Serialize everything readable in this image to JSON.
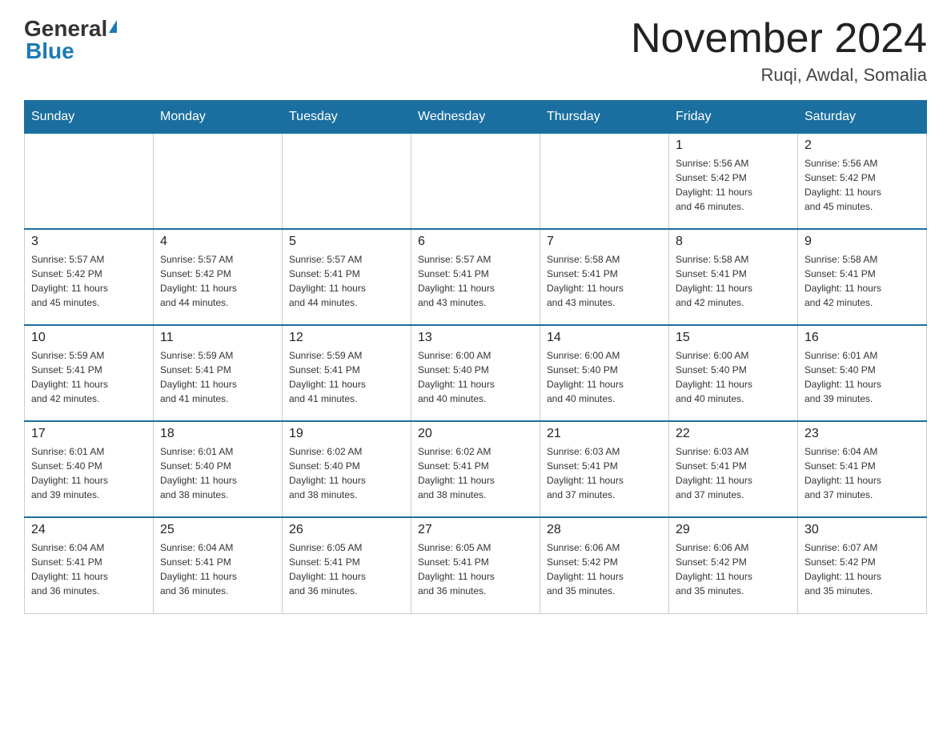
{
  "header": {
    "logo_general": "General",
    "logo_blue": "Blue",
    "month_title": "November 2024",
    "location": "Ruqi, Awdal, Somalia"
  },
  "weekdays": [
    "Sunday",
    "Monday",
    "Tuesday",
    "Wednesday",
    "Thursday",
    "Friday",
    "Saturday"
  ],
  "weeks": [
    [
      {
        "day": "",
        "info": ""
      },
      {
        "day": "",
        "info": ""
      },
      {
        "day": "",
        "info": ""
      },
      {
        "day": "",
        "info": ""
      },
      {
        "day": "",
        "info": ""
      },
      {
        "day": "1",
        "info": "Sunrise: 5:56 AM\nSunset: 5:42 PM\nDaylight: 11 hours\nand 46 minutes."
      },
      {
        "day": "2",
        "info": "Sunrise: 5:56 AM\nSunset: 5:42 PM\nDaylight: 11 hours\nand 45 minutes."
      }
    ],
    [
      {
        "day": "3",
        "info": "Sunrise: 5:57 AM\nSunset: 5:42 PM\nDaylight: 11 hours\nand 45 minutes."
      },
      {
        "day": "4",
        "info": "Sunrise: 5:57 AM\nSunset: 5:42 PM\nDaylight: 11 hours\nand 44 minutes."
      },
      {
        "day": "5",
        "info": "Sunrise: 5:57 AM\nSunset: 5:41 PM\nDaylight: 11 hours\nand 44 minutes."
      },
      {
        "day": "6",
        "info": "Sunrise: 5:57 AM\nSunset: 5:41 PM\nDaylight: 11 hours\nand 43 minutes."
      },
      {
        "day": "7",
        "info": "Sunrise: 5:58 AM\nSunset: 5:41 PM\nDaylight: 11 hours\nand 43 minutes."
      },
      {
        "day": "8",
        "info": "Sunrise: 5:58 AM\nSunset: 5:41 PM\nDaylight: 11 hours\nand 42 minutes."
      },
      {
        "day": "9",
        "info": "Sunrise: 5:58 AM\nSunset: 5:41 PM\nDaylight: 11 hours\nand 42 minutes."
      }
    ],
    [
      {
        "day": "10",
        "info": "Sunrise: 5:59 AM\nSunset: 5:41 PM\nDaylight: 11 hours\nand 42 minutes."
      },
      {
        "day": "11",
        "info": "Sunrise: 5:59 AM\nSunset: 5:41 PM\nDaylight: 11 hours\nand 41 minutes."
      },
      {
        "day": "12",
        "info": "Sunrise: 5:59 AM\nSunset: 5:41 PM\nDaylight: 11 hours\nand 41 minutes."
      },
      {
        "day": "13",
        "info": "Sunrise: 6:00 AM\nSunset: 5:40 PM\nDaylight: 11 hours\nand 40 minutes."
      },
      {
        "day": "14",
        "info": "Sunrise: 6:00 AM\nSunset: 5:40 PM\nDaylight: 11 hours\nand 40 minutes."
      },
      {
        "day": "15",
        "info": "Sunrise: 6:00 AM\nSunset: 5:40 PM\nDaylight: 11 hours\nand 40 minutes."
      },
      {
        "day": "16",
        "info": "Sunrise: 6:01 AM\nSunset: 5:40 PM\nDaylight: 11 hours\nand 39 minutes."
      }
    ],
    [
      {
        "day": "17",
        "info": "Sunrise: 6:01 AM\nSunset: 5:40 PM\nDaylight: 11 hours\nand 39 minutes."
      },
      {
        "day": "18",
        "info": "Sunrise: 6:01 AM\nSunset: 5:40 PM\nDaylight: 11 hours\nand 38 minutes."
      },
      {
        "day": "19",
        "info": "Sunrise: 6:02 AM\nSunset: 5:40 PM\nDaylight: 11 hours\nand 38 minutes."
      },
      {
        "day": "20",
        "info": "Sunrise: 6:02 AM\nSunset: 5:41 PM\nDaylight: 11 hours\nand 38 minutes."
      },
      {
        "day": "21",
        "info": "Sunrise: 6:03 AM\nSunset: 5:41 PM\nDaylight: 11 hours\nand 37 minutes."
      },
      {
        "day": "22",
        "info": "Sunrise: 6:03 AM\nSunset: 5:41 PM\nDaylight: 11 hours\nand 37 minutes."
      },
      {
        "day": "23",
        "info": "Sunrise: 6:04 AM\nSunset: 5:41 PM\nDaylight: 11 hours\nand 37 minutes."
      }
    ],
    [
      {
        "day": "24",
        "info": "Sunrise: 6:04 AM\nSunset: 5:41 PM\nDaylight: 11 hours\nand 36 minutes."
      },
      {
        "day": "25",
        "info": "Sunrise: 6:04 AM\nSunset: 5:41 PM\nDaylight: 11 hours\nand 36 minutes."
      },
      {
        "day": "26",
        "info": "Sunrise: 6:05 AM\nSunset: 5:41 PM\nDaylight: 11 hours\nand 36 minutes."
      },
      {
        "day": "27",
        "info": "Sunrise: 6:05 AM\nSunset: 5:41 PM\nDaylight: 11 hours\nand 36 minutes."
      },
      {
        "day": "28",
        "info": "Sunrise: 6:06 AM\nSunset: 5:42 PM\nDaylight: 11 hours\nand 35 minutes."
      },
      {
        "day": "29",
        "info": "Sunrise: 6:06 AM\nSunset: 5:42 PM\nDaylight: 11 hours\nand 35 minutes."
      },
      {
        "day": "30",
        "info": "Sunrise: 6:07 AM\nSunset: 5:42 PM\nDaylight: 11 hours\nand 35 minutes."
      }
    ]
  ]
}
